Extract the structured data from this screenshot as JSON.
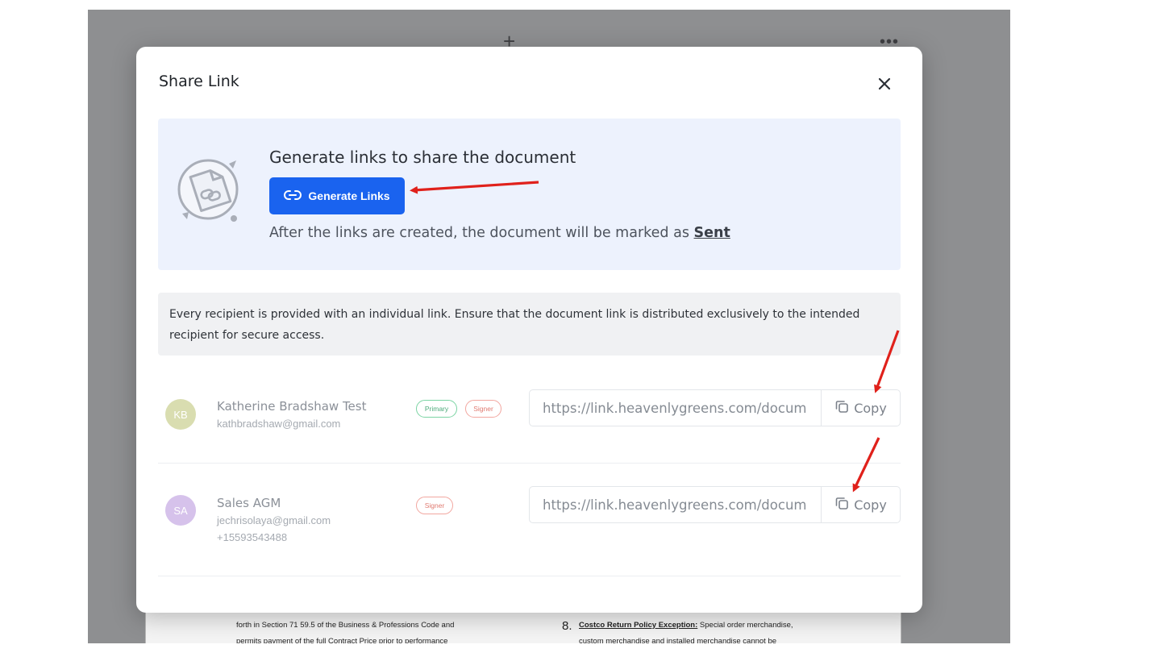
{
  "background": {
    "doc_lines": [
      "forth in Section 71 59.5 of the Business & Professions Code and",
      "permits payment of the full Contract Price prior to performance"
    ],
    "doc_item_number": "8.",
    "doc_item_title": "Costco Return Policy Exception:",
    "doc_item_text": "Special order merchandise,",
    "doc_item_line2": "custom merchandise and installed merchandise cannot be"
  },
  "modal": {
    "title": "Share Link",
    "generate": {
      "heading": "Generate links to share the document",
      "button_label": "Generate Links",
      "note_prefix": "After the links are created, the document will be marked as ",
      "note_status": "Sent"
    },
    "info_text": "Every recipient is provided with an individual link. Ensure that the document link is distributed exclusively to the intended recipient for secure access.",
    "recipients": [
      {
        "initials": "KB",
        "avatar_color": "#d9ddb0",
        "name": "Katherine Bradshaw Test",
        "email": "kathbradshaw@gmail.com",
        "phone": "",
        "badges": [
          "Primary",
          "Signer"
        ],
        "link_value": "https://link.heavenlygreens.com/docum",
        "copy_label": "Copy"
      },
      {
        "initials": "SA",
        "avatar_color": "#d6c2eb",
        "name": "Sales AGM",
        "email": "jechrisolaya@gmail.com",
        "phone": "+15593543488",
        "badges": [
          "Signer"
        ],
        "link_value": "https://link.heavenlygreens.com/docum",
        "copy_label": "Copy"
      }
    ]
  },
  "colors": {
    "primary_button": "#1a63ef",
    "annotation_arrow": "#e0211b"
  }
}
